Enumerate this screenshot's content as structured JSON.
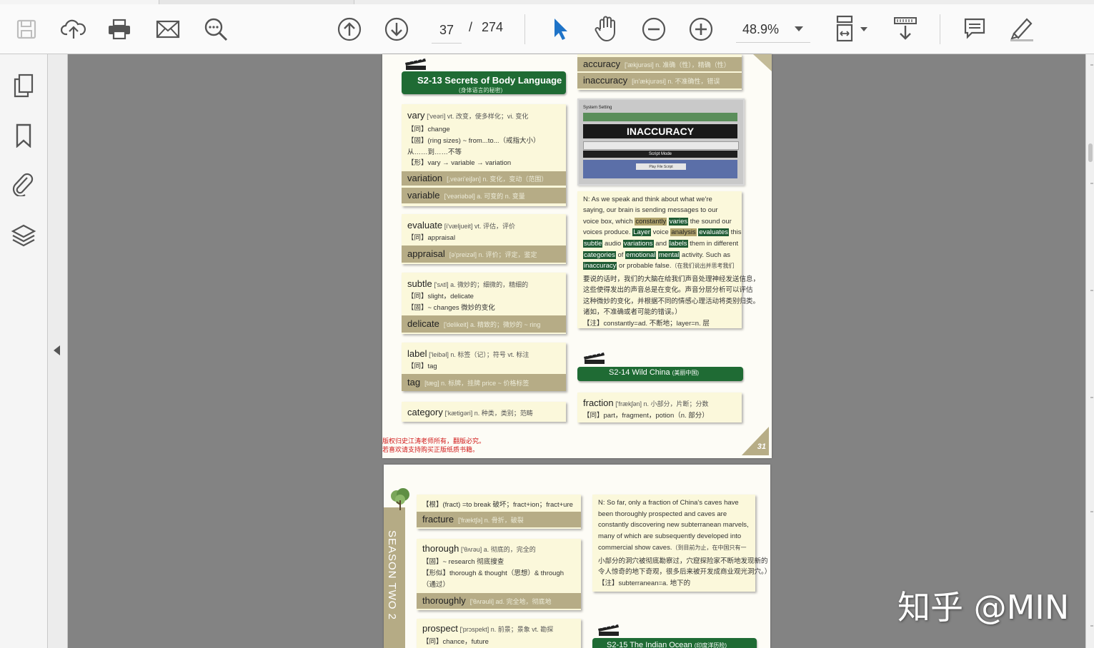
{
  "toolbar": {
    "page_current": "37",
    "page_sep": "/",
    "page_total": "274",
    "zoom": "48.9%"
  },
  "icons": [
    "save-icon",
    "cloud-upload-icon",
    "print-icon",
    "mail-icon",
    "search-zoom-icon",
    "page-up-icon",
    "page-down-icon",
    "select-arrow-icon",
    "hand-icon",
    "zoom-out-icon",
    "zoom-in-icon",
    "fit-page-icon",
    "scroll-mode-icon",
    "comment-icon",
    "highlight-pen-icon",
    "pages-icon",
    "bookmark-icon",
    "attachment-icon",
    "layers-icon"
  ],
  "colors": {
    "header_green": "#1f6b34",
    "card_yellow": "#fbf8db",
    "bar_tan": "#b6ac86",
    "viewer_bg": "#838383"
  },
  "page1": {
    "sec13_title": "S2-13  Secrets of Body Language",
    "sec13_sub": "(身体语言的秘密)",
    "vary": {
      "word": "vary",
      "head": "['veəri] vt. 改变，使多样化；vi. 变化",
      "l1": "【同】change",
      "l2": "【固】(ring sizes) ~ from...to...（戒指大小）",
      "l3": "从……到……不等",
      "l4": "【形】vary → variable → variation"
    },
    "variation": {
      "word": "variation",
      "gloss": "[,veəri'eiʃən] n. 变化，变动（范围）"
    },
    "variable": {
      "word": "variable",
      "gloss": "['veəriəbəl] a. 可变的 n. 变量"
    },
    "evaluate": {
      "word": "evaluate",
      "head": "[i'væljueit] vt. 评估，评价",
      "l1": "【同】appraisal"
    },
    "appraisal": {
      "word": "appraisal",
      "gloss": "[ə'preizəl] n. 评价；评定，鉴定"
    },
    "subtle": {
      "word": "subtle",
      "head": "['sʌtl] a. 微妙的；细微的，精细的",
      "l1": "【同】slight，delicate",
      "l2": "【固】~ changes 微妙的变化"
    },
    "delicate": {
      "word": "delicate",
      "gloss": "['delikeit] a. 精致的；微妙的  ~ ring"
    },
    "label": {
      "word": "label",
      "head": "['leibəl] n. 标签（记）；符号 vt. 标注",
      "l1": "【同】tag"
    },
    "tag": {
      "word": "tag",
      "gloss": "[tæg] n. 标牌，挂牌  price ~ 价格标签"
    },
    "category": {
      "word": "category",
      "head": "['kætigəri] n. 种类，类别；范畴"
    },
    "accuracy": {
      "word": "accuracy",
      "gloss": "['ækjurəsi] n. 准确（性），精确（性）"
    },
    "inaccuracy": {
      "word": "inaccuracy",
      "gloss": "[in'ækjurəsi] n. 不准确性，错误"
    },
    "shot": {
      "sys": "System Setting",
      "title": "INACCURACY",
      "mode": "Script Mode",
      "btn": "Play File Script"
    },
    "note": {
      "l1a": "N: As we speak and think about what we're",
      "l2a": "saying, our brain is sending messages to our",
      "l3a": "voice box, which ",
      "l3b": "constantly",
      "l3c": " ",
      "l3d": "varies",
      "l3e": " the sound our",
      "l4a": "voices produce. ",
      "l4b": "Layer",
      "l4c": " voice ",
      "l4d": "analysis",
      "l4e": " ",
      "l4f": "evaluates",
      "l4g": " this",
      "l5a": "subtle",
      "l5b": " audio ",
      "l5c": "variations",
      "l5d": " and ",
      "l5e": "labels",
      "l5f": " them in different",
      "l6a": "categories",
      "l6b": " of ",
      "l6c": "emotional",
      "l6d": " ",
      "l6e": "mental",
      "l6f": " activity. Such as",
      "l7a": "inaccuracy",
      "l7b": " or probable false.",
      "l7c": "（在我们说出并思考我们",
      "l8": "要说的话时，我们的大脑在给我们声音处理神经发送信息，",
      "l9": "这些使得发出的声音总是在变化。声音分层分析可以评估",
      "l10": "这种微妙的变化，并根据不同的情感心理活动将类别归类。",
      "l11": "诸如，不准确或者可能的错误。）",
      "l12": "【注】constantly=ad. 不断地；layer=n. 层"
    },
    "sec14_title": "S2-14  Wild China",
    "sec14_sub": "(美丽中国)",
    "fraction": {
      "word": "fraction",
      "head": "['frækʃən] n. 小部分，片断；分数",
      "l1": "【同】part，fragment，potion（n. 部分）"
    },
    "copyright_1": "版权归史江涛老师所有，翻版必究。",
    "copyright_2": "若喜欢请支持购买正版纸质书籍。",
    "page_number": "31"
  },
  "page2": {
    "season": "SEASON TWO 2",
    "root": "【根】(fract) =to break 破坏；fract+ion；fract+ure",
    "fracture": {
      "word": "fracture",
      "gloss": "['fræktʃə] n. 骨折，破裂"
    },
    "thorough": {
      "word": "thorough",
      "head": "['θʌrəu] a. 彻底的，完全的",
      "l1": "【固】~ research 彻底搜查",
      "l2": "【形似】thorough & thought（思想）& through",
      "l3": "（通过）"
    },
    "thoroughly": {
      "word": "thoroughly",
      "gloss": "['θʌrəuli] ad. 完全地，彻底地"
    },
    "prospect": {
      "word": "prospect",
      "head": "['prɔspekt] n. 前景；景象 vt. 勘探",
      "l1": "【同】chance，future"
    },
    "note": {
      "l1": "N: So far, only a fraction of China's caves have",
      "l2": "been thoroughly prospected and caves are",
      "l3": "constantly discovering new subterranean marvels,",
      "l4": "many of which are subsequently developed into",
      "l5a": "commercial show caves.",
      "l5b": "（到目前为止，在中国只有一",
      "l6": "小部分的洞穴被彻底勘察过，穴窟探险家不断地发现新的",
      "l7": "令人惊奇的地下奇观，很多后来被开发成商业观光洞穴。）",
      "l8": "【注】subterranean=a. 地下的"
    },
    "sec15_title": "S2-15  The Indian Ocean",
    "sec15_sub": "(印度洋历险)"
  },
  "watermark": "知乎 @MIN"
}
